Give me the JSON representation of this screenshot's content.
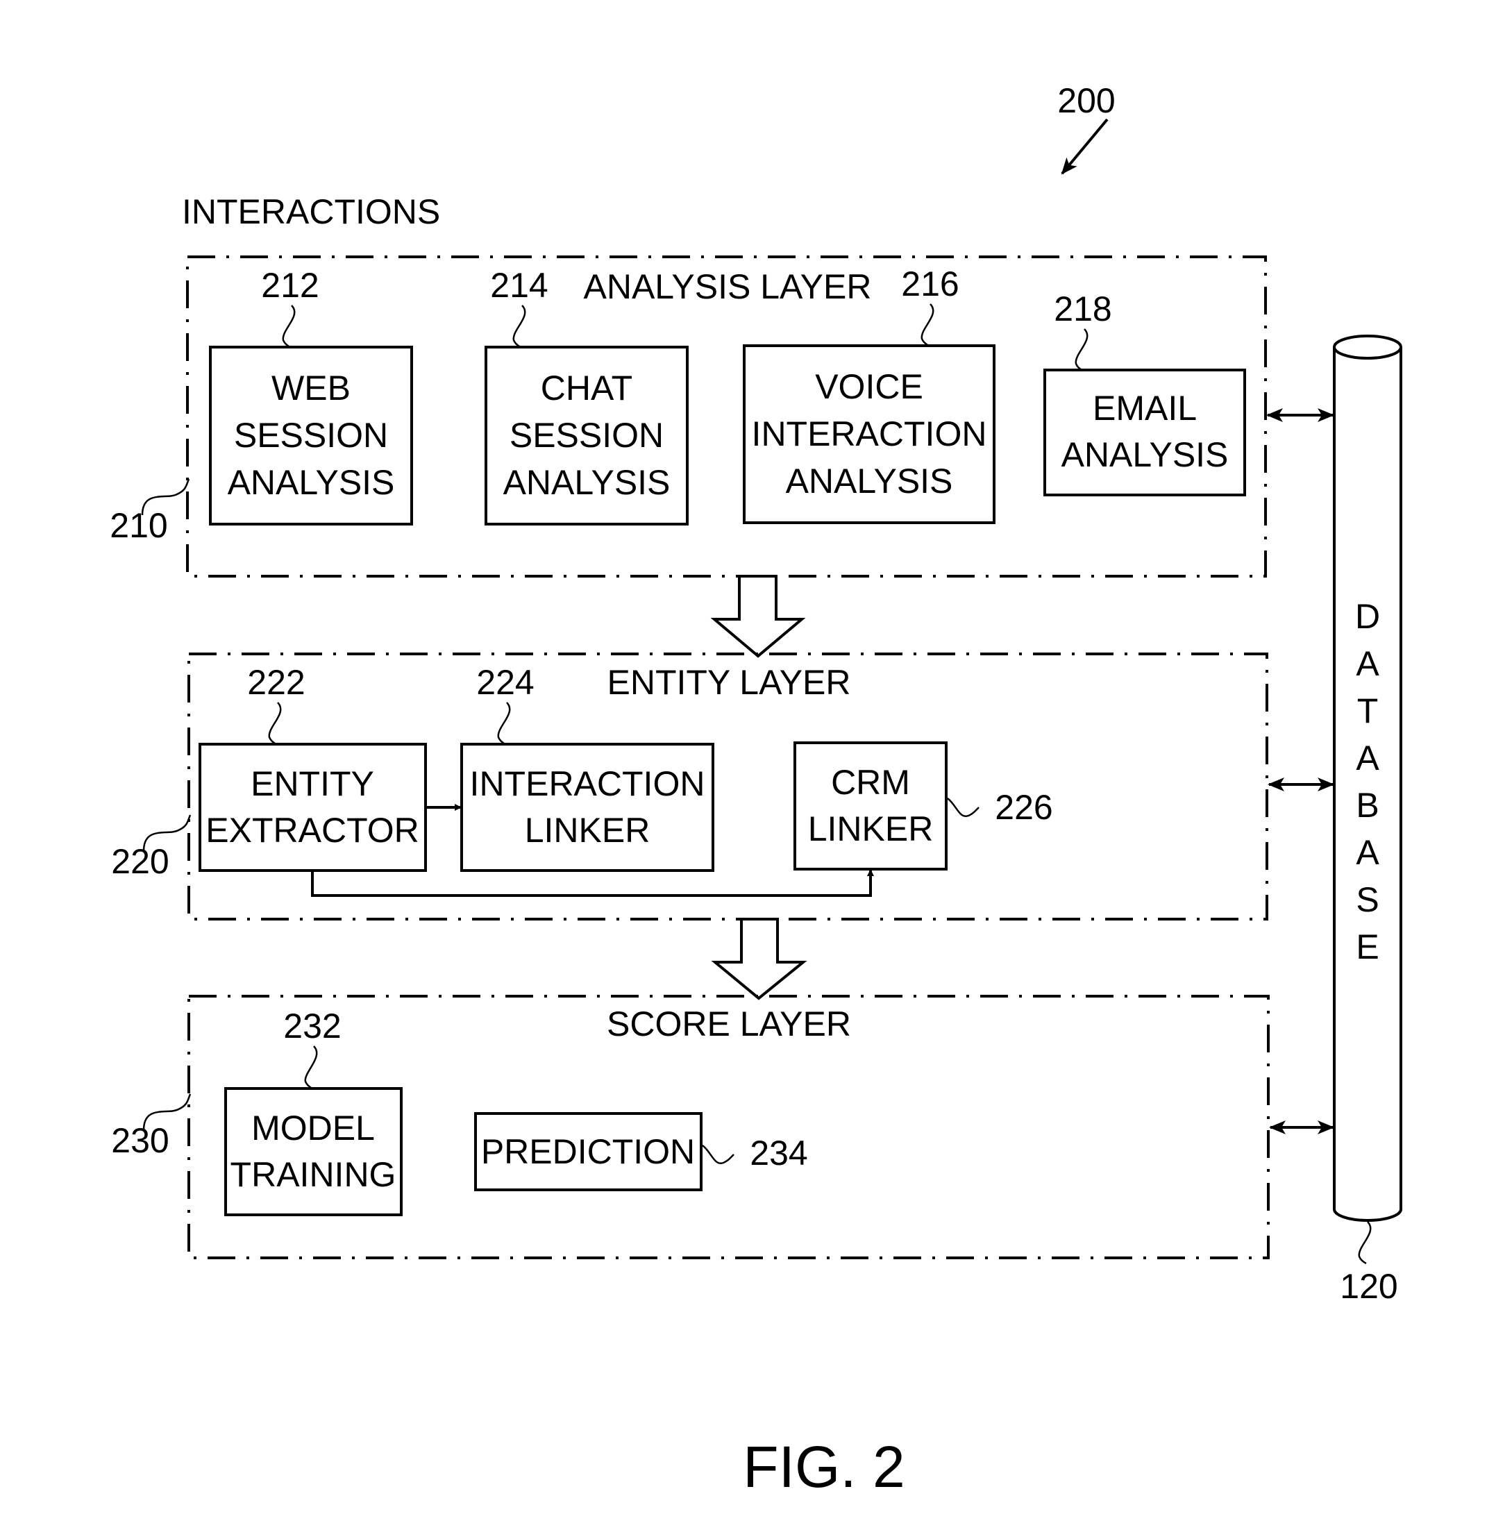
{
  "figure": {
    "ref": "200",
    "caption": "FIG. 2",
    "interactions_label": "INTERACTIONS"
  },
  "layers": [
    {
      "ref": "210",
      "title": "ANALYSIS LAYER",
      "components": [
        {
          "ref": "212",
          "lines": [
            "WEB",
            "SESSION",
            "ANALYSIS"
          ]
        },
        {
          "ref": "214",
          "lines": [
            "CHAT",
            "SESSION",
            "ANALYSIS"
          ]
        },
        {
          "ref": "216",
          "lines": [
            "VOICE",
            "INTERACTION",
            "ANALYSIS"
          ]
        },
        {
          "ref": "218",
          "lines": [
            "EMAIL",
            "ANALYSIS"
          ]
        }
      ]
    },
    {
      "ref": "220",
      "title": "ENTITY LAYER",
      "components": [
        {
          "ref": "222",
          "lines": [
            "ENTITY",
            "EXTRACTOR"
          ]
        },
        {
          "ref": "224",
          "lines": [
            "INTERACTION",
            "LINKER"
          ]
        },
        {
          "ref": "226",
          "lines": [
            "CRM",
            "LINKER"
          ]
        }
      ]
    },
    {
      "ref": "230",
      "title": "SCORE LAYER",
      "components": [
        {
          "ref": "232",
          "lines": [
            "MODEL",
            "TRAINING"
          ]
        },
        {
          "ref": "234",
          "lines": [
            "PREDICTION"
          ]
        }
      ]
    }
  ],
  "database": {
    "ref": "120",
    "letters": [
      "D",
      "A",
      "T",
      "A",
      "B",
      "A",
      "S",
      "E"
    ]
  }
}
